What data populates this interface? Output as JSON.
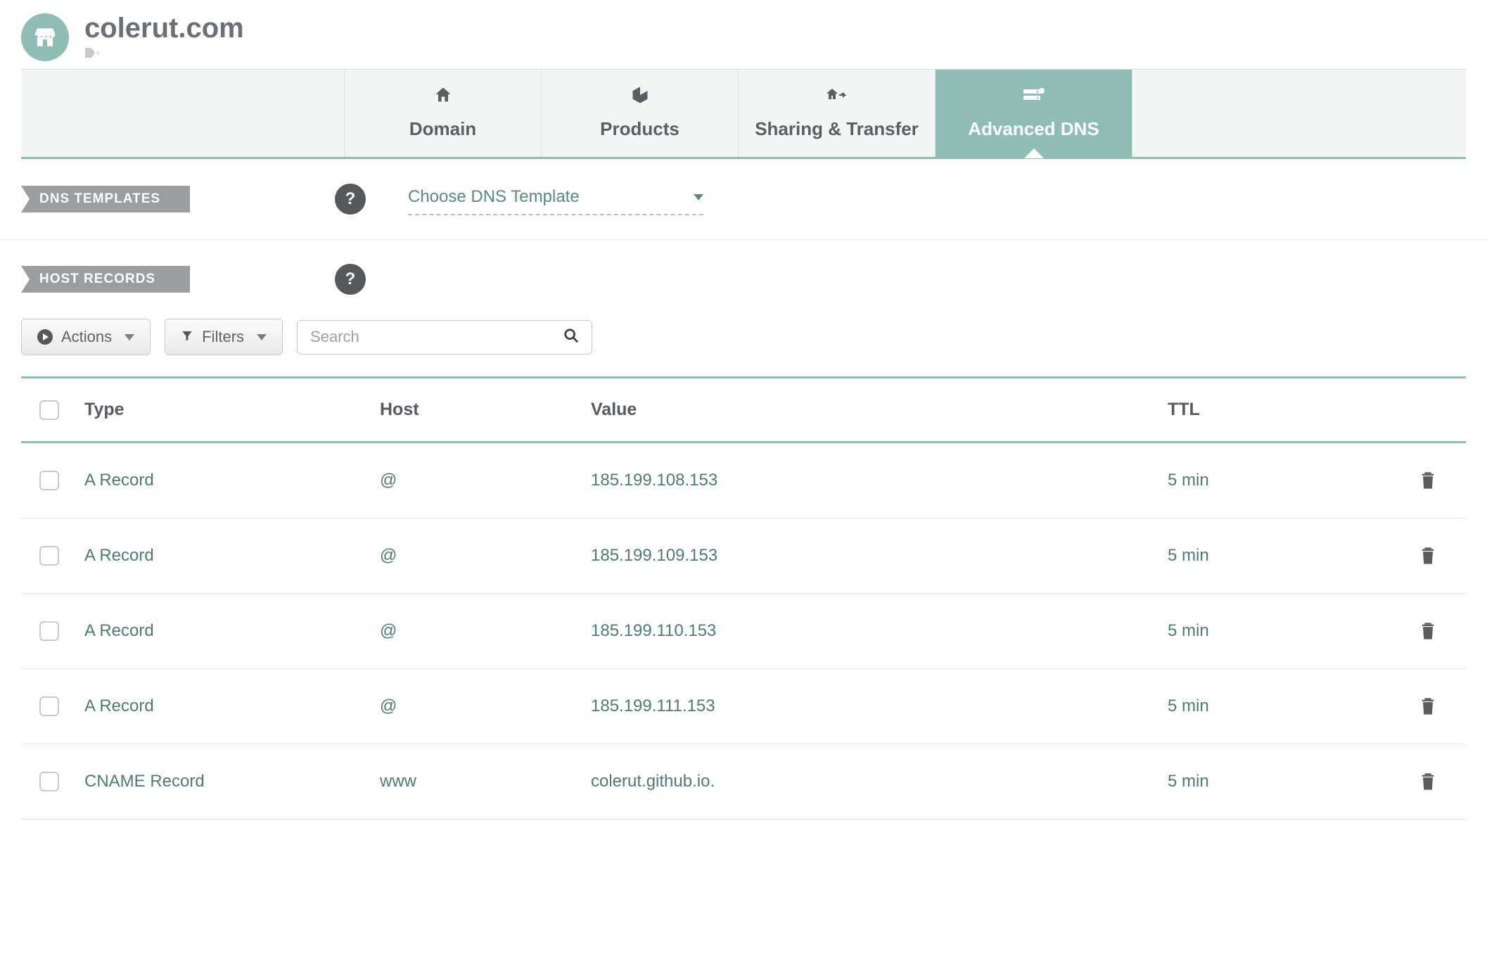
{
  "header": {
    "domain": "colerut.com"
  },
  "tabs": [
    {
      "label": "Domain"
    },
    {
      "label": "Products"
    },
    {
      "label": "Sharing & Transfer"
    },
    {
      "label": "Advanced DNS"
    }
  ],
  "sections": {
    "templates_label": "DNS TEMPLATES",
    "templates_select": "Choose DNS Template",
    "hosts_label": "HOST RECORDS"
  },
  "toolbar": {
    "actions_label": "Actions",
    "filters_label": "Filters",
    "search_placeholder": "Search"
  },
  "table": {
    "headers": {
      "type": "Type",
      "host": "Host",
      "value": "Value",
      "ttl": "TTL"
    },
    "rows": [
      {
        "type": "A Record",
        "host": "@",
        "value": "185.199.108.153",
        "ttl": "5 min"
      },
      {
        "type": "A Record",
        "host": "@",
        "value": "185.199.109.153",
        "ttl": "5 min"
      },
      {
        "type": "A Record",
        "host": "@",
        "value": "185.199.110.153",
        "ttl": "5 min"
      },
      {
        "type": "A Record",
        "host": "@",
        "value": "185.199.111.153",
        "ttl": "5 min"
      },
      {
        "type": "CNAME Record",
        "host": "www",
        "value": "colerut.github.io.",
        "ttl": "5 min"
      }
    ]
  }
}
